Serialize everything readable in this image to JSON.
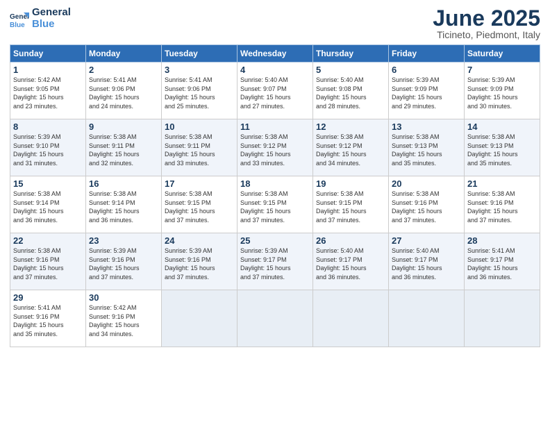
{
  "logo": {
    "line1": "General",
    "line2": "Blue"
  },
  "title": "June 2025",
  "subtitle": "Ticineto, Piedmont, Italy",
  "weekdays": [
    "Sunday",
    "Monday",
    "Tuesday",
    "Wednesday",
    "Thursday",
    "Friday",
    "Saturday"
  ],
  "weeks": [
    [
      {
        "day": 1,
        "info": "Sunrise: 5:42 AM\nSunset: 9:05 PM\nDaylight: 15 hours\nand 23 minutes."
      },
      {
        "day": 2,
        "info": "Sunrise: 5:41 AM\nSunset: 9:06 PM\nDaylight: 15 hours\nand 24 minutes."
      },
      {
        "day": 3,
        "info": "Sunrise: 5:41 AM\nSunset: 9:06 PM\nDaylight: 15 hours\nand 25 minutes."
      },
      {
        "day": 4,
        "info": "Sunrise: 5:40 AM\nSunset: 9:07 PM\nDaylight: 15 hours\nand 27 minutes."
      },
      {
        "day": 5,
        "info": "Sunrise: 5:40 AM\nSunset: 9:08 PM\nDaylight: 15 hours\nand 28 minutes."
      },
      {
        "day": 6,
        "info": "Sunrise: 5:39 AM\nSunset: 9:09 PM\nDaylight: 15 hours\nand 29 minutes."
      },
      {
        "day": 7,
        "info": "Sunrise: 5:39 AM\nSunset: 9:09 PM\nDaylight: 15 hours\nand 30 minutes."
      }
    ],
    [
      {
        "day": 8,
        "info": "Sunrise: 5:39 AM\nSunset: 9:10 PM\nDaylight: 15 hours\nand 31 minutes."
      },
      {
        "day": 9,
        "info": "Sunrise: 5:38 AM\nSunset: 9:11 PM\nDaylight: 15 hours\nand 32 minutes."
      },
      {
        "day": 10,
        "info": "Sunrise: 5:38 AM\nSunset: 9:11 PM\nDaylight: 15 hours\nand 33 minutes."
      },
      {
        "day": 11,
        "info": "Sunrise: 5:38 AM\nSunset: 9:12 PM\nDaylight: 15 hours\nand 33 minutes."
      },
      {
        "day": 12,
        "info": "Sunrise: 5:38 AM\nSunset: 9:12 PM\nDaylight: 15 hours\nand 34 minutes."
      },
      {
        "day": 13,
        "info": "Sunrise: 5:38 AM\nSunset: 9:13 PM\nDaylight: 15 hours\nand 35 minutes."
      },
      {
        "day": 14,
        "info": "Sunrise: 5:38 AM\nSunset: 9:13 PM\nDaylight: 15 hours\nand 35 minutes."
      }
    ],
    [
      {
        "day": 15,
        "info": "Sunrise: 5:38 AM\nSunset: 9:14 PM\nDaylight: 15 hours\nand 36 minutes."
      },
      {
        "day": 16,
        "info": "Sunrise: 5:38 AM\nSunset: 9:14 PM\nDaylight: 15 hours\nand 36 minutes."
      },
      {
        "day": 17,
        "info": "Sunrise: 5:38 AM\nSunset: 9:15 PM\nDaylight: 15 hours\nand 37 minutes."
      },
      {
        "day": 18,
        "info": "Sunrise: 5:38 AM\nSunset: 9:15 PM\nDaylight: 15 hours\nand 37 minutes."
      },
      {
        "day": 19,
        "info": "Sunrise: 5:38 AM\nSunset: 9:15 PM\nDaylight: 15 hours\nand 37 minutes."
      },
      {
        "day": 20,
        "info": "Sunrise: 5:38 AM\nSunset: 9:16 PM\nDaylight: 15 hours\nand 37 minutes."
      },
      {
        "day": 21,
        "info": "Sunrise: 5:38 AM\nSunset: 9:16 PM\nDaylight: 15 hours\nand 37 minutes."
      }
    ],
    [
      {
        "day": 22,
        "info": "Sunrise: 5:38 AM\nSunset: 9:16 PM\nDaylight: 15 hours\nand 37 minutes."
      },
      {
        "day": 23,
        "info": "Sunrise: 5:39 AM\nSunset: 9:16 PM\nDaylight: 15 hours\nand 37 minutes."
      },
      {
        "day": 24,
        "info": "Sunrise: 5:39 AM\nSunset: 9:16 PM\nDaylight: 15 hours\nand 37 minutes."
      },
      {
        "day": 25,
        "info": "Sunrise: 5:39 AM\nSunset: 9:17 PM\nDaylight: 15 hours\nand 37 minutes."
      },
      {
        "day": 26,
        "info": "Sunrise: 5:40 AM\nSunset: 9:17 PM\nDaylight: 15 hours\nand 36 minutes."
      },
      {
        "day": 27,
        "info": "Sunrise: 5:40 AM\nSunset: 9:17 PM\nDaylight: 15 hours\nand 36 minutes."
      },
      {
        "day": 28,
        "info": "Sunrise: 5:41 AM\nSunset: 9:17 PM\nDaylight: 15 hours\nand 36 minutes."
      }
    ],
    [
      {
        "day": 29,
        "info": "Sunrise: 5:41 AM\nSunset: 9:16 PM\nDaylight: 15 hours\nand 35 minutes."
      },
      {
        "day": 30,
        "info": "Sunrise: 5:42 AM\nSunset: 9:16 PM\nDaylight: 15 hours\nand 34 minutes."
      },
      null,
      null,
      null,
      null,
      null
    ]
  ]
}
